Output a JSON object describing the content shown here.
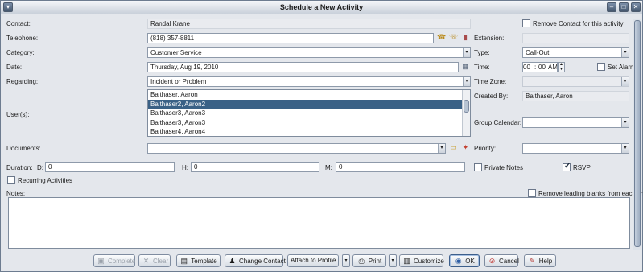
{
  "window": {
    "title": "Schedule a New Activity",
    "menu_glyph": "▾",
    "minimize_glyph": "–",
    "maximize_glyph": "□",
    "close_glyph": "✕"
  },
  "form": {
    "contact": {
      "label": "Contact:",
      "value": "Randal Krane"
    },
    "remove_contact": {
      "label": "Remove Contact for this activity",
      "checked": false
    },
    "telephone": {
      "label": "Telephone:",
      "value": "(818) 357-8811"
    },
    "extension": {
      "label": "Extension:",
      "value": ""
    },
    "category": {
      "label": "Category:",
      "value": "Customer Service"
    },
    "type": {
      "label": "Type:",
      "value": "Call-Out"
    },
    "date": {
      "label": "Date:",
      "value": "Thursday, Aug 19, 2010"
    },
    "time": {
      "label": "Time:",
      "hour": "00",
      "sep": ":",
      "minute": "00",
      "ampm": "AM"
    },
    "set_alarm": {
      "label": "Set Alarm",
      "checked": false
    },
    "regarding": {
      "label": "Regarding:",
      "value": "Incident or Problem"
    },
    "time_zone": {
      "label": "Time Zone:",
      "value": ""
    },
    "users": {
      "label": "User(s):",
      "items": [
        "Balthaser, Aaron",
        "Balthaser2, Aaron2",
        "Balthaser3, Aaron3",
        "Balthaser3, Aaron3",
        "Balthaser4, Aaron4"
      ],
      "selected_index": 1
    },
    "created_by": {
      "label": "Created By:",
      "value": "Balthaser, Aaron"
    },
    "group_calendar": {
      "label": "Group Calendar:",
      "value": ""
    },
    "documents": {
      "label": "Documents:",
      "value": ""
    },
    "priority": {
      "label": "Priority:",
      "value": ""
    },
    "duration": {
      "label": "Duration:",
      "d_label": "D:",
      "d_value": "0",
      "h_label": "H:",
      "h_value": "0",
      "m_label": "M:",
      "m_value": "0"
    },
    "private_notes": {
      "label": "Private Notes",
      "checked": false
    },
    "rsvp": {
      "label": "RSVP",
      "checked": true
    },
    "recurring": {
      "label": "Recurring Activities",
      "checked": false
    },
    "notes": {
      "label": "Notes:",
      "value": ""
    },
    "remove_blanks": {
      "label": "Remove leading blanks from each line",
      "checked": false
    }
  },
  "buttons": {
    "complete": "Complete",
    "clear": "Clear",
    "template": "Template",
    "change_contact": "Change Contact",
    "attach_to_profile": "Attach to Profile",
    "print": "Print",
    "customize": "Customize",
    "ok": "OK",
    "cancel": "Cancel",
    "help": "Help"
  },
  "icons": {
    "dropdown": "▾",
    "phone": "☎",
    "phone2": "☏",
    "dial": "▮",
    "calendar": "▦",
    "folder": "▭",
    "attach": "✦",
    "spin_up": "▲",
    "spin_down": "▼",
    "complete": "▣",
    "clear": "✕",
    "template": "▤",
    "change_contact": "♟",
    "print": "⎙",
    "customize": "▥",
    "ok": "◉",
    "cancel": "⊘",
    "help": "✎"
  },
  "colors": {
    "selection": "#3a6186",
    "title_gradient_top": "#f5f7fa",
    "title_gradient_bottom": "#c9d0da"
  }
}
